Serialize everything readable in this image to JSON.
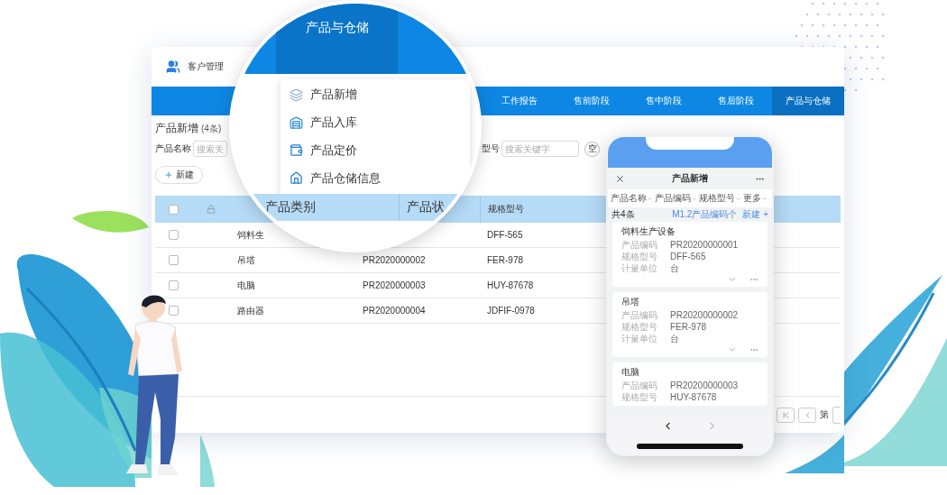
{
  "app": {
    "title": "客户管理"
  },
  "nav": [
    {
      "label": "工作报告",
      "selected": false
    },
    {
      "label": "售前阶段",
      "selected": false
    },
    {
      "label": "售中阶段",
      "selected": false
    },
    {
      "label": "售后阶段",
      "selected": false
    },
    {
      "label": "产品与仓储",
      "selected": true
    }
  ],
  "magnifier": {
    "tab": {
      "label": "产品与仓储",
      "selected": true
    },
    "menu": [
      {
        "label": "产品新增",
        "kind": "layers"
      },
      {
        "label": "产品入库",
        "kind": "warehouse"
      },
      {
        "label": "产品定价",
        "kind": "pricing"
      },
      {
        "label": "产品仓储信息",
        "kind": "house"
      }
    ],
    "columns": [
      "产品类别",
      "产品状"
    ]
  },
  "page": {
    "title": "产品新增",
    "count": "(4条)"
  },
  "filters": [
    {
      "label": "产品名称",
      "placeholder": "搜索关"
    },
    {
      "label": "型号",
      "placeholder": "搜索关键字"
    }
  ],
  "clear_button": "空",
  "new_button": "新建",
  "table": {
    "header_checked": false,
    "columns": [
      "规格型号"
    ],
    "rows": [
      {
        "checked": false,
        "name": "饲料生",
        "model": "DFF-565"
      },
      {
        "checked": false,
        "name": "吊塔",
        "code": "PR2020000002",
        "model": "FER-978"
      },
      {
        "checked": false,
        "name": "电脑",
        "code": "PR2020000003",
        "model": "HUY-87678"
      },
      {
        "checked": false,
        "name": "路由器",
        "code": "PR2020000004",
        "model": "JDFIF-0978"
      }
    ]
  },
  "pagination": {
    "page_label": "第"
  },
  "phone": {
    "title": "产品新增",
    "filters": [
      "产品名称",
      "产品编码",
      "规格型号",
      "更多"
    ],
    "total": "共4条",
    "sort": "M1.2产品编码个",
    "add": "新建 +",
    "cards": [
      {
        "title": "饲料生产设备",
        "fields": [
          {
            "label": "产品编码",
            "value": "PR20200000001"
          },
          {
            "label": "规格型号",
            "value": "DFF-565"
          },
          {
            "label": "计量单位",
            "value": "台"
          }
        ]
      },
      {
        "title": "吊塔",
        "fields": [
          {
            "label": "产品编码",
            "value": "PR20200000002"
          },
          {
            "label": "规格型号",
            "value": "FER-978"
          },
          {
            "label": "计量单位",
            "value": "台"
          }
        ]
      },
      {
        "title": "电脑",
        "fields": [
          {
            "label": "产品编码",
            "value": "PR20200000003"
          },
          {
            "label": "规格型号",
            "value": "HUY-87678"
          }
        ]
      }
    ]
  }
}
